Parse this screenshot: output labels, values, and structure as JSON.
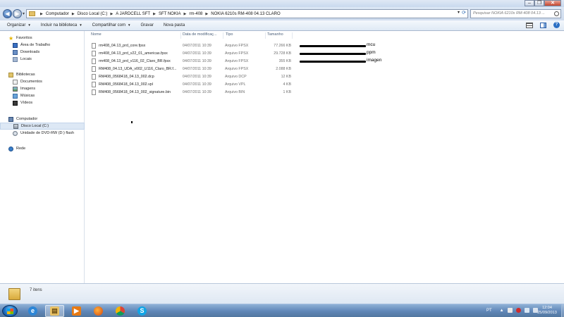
{
  "address": {
    "breadcrumbs": [
      "Computador",
      "Disco Local (C:)",
      "A JARDCELL SFT",
      "SFT NOKIA",
      "rm-408",
      "NOKIA 6210s RM-408 04.13 CLARO"
    ],
    "search_placeholder": "Pesquisar NOKIA 6210s RM-408 04.13 ..."
  },
  "toolbar": {
    "organize": "Organizar",
    "include": "Incluir na biblioteca",
    "share": "Compartilhar com",
    "burn": "Gravar",
    "new_folder": "Nova pasta"
  },
  "nav": {
    "favorites": {
      "label": "Favoritos",
      "items": [
        "Área de Trabalho",
        "Downloads",
        "Locais"
      ]
    },
    "libraries": {
      "label": "Bibliotecas",
      "items": [
        "Documentos",
        "Imagens",
        "Músicas",
        "Vídeos"
      ]
    },
    "computer": {
      "label": "Computador",
      "items": [
        "Disco Local (C:)",
        "Unidade de DVD-RW (D:) flash"
      ]
    },
    "network": {
      "label": "Rede"
    }
  },
  "columns": {
    "name": "Nome",
    "date": "Data de modificaç...",
    "type": "Tipo",
    "size": "Tamanho"
  },
  "files": [
    {
      "name": "rm408_04.13_prd_core.fpsx",
      "date": "04/07/2011 10:39",
      "type": "Arquivo FPSX",
      "size": "77.266 KB",
      "annotation": "mcu"
    },
    {
      "name": "rm408_04.13_prd_v22_01_americas.fpsx",
      "date": "04/07/2011 10:39",
      "type": "Arquivo FPSX",
      "size": "29.728 KB",
      "annotation": "ppm"
    },
    {
      "name": "rm408_04.13_prd_v116_02_Claro_BR.fpsx",
      "date": "04/07/2011 10:39",
      "type": "Arquivo FPSX",
      "size": "355 KB",
      "annotation": "imagen"
    },
    {
      "name": "RM408_04.13_UDA_v002_U116_Claro_BR.f...",
      "date": "04/07/2011 10:39",
      "type": "Arquivo FPSX",
      "size": "2.088 KB"
    },
    {
      "name": "RM408_0568418_04.13_002.dcp",
      "date": "04/07/2011 10:39",
      "type": "Arquivo DCP",
      "size": "12 KB"
    },
    {
      "name": "RM408_0568418_04.13_002.vpl",
      "date": "04/07/2011 10:39",
      "type": "Arquivo VPL",
      "size": "4 KB"
    },
    {
      "name": "RM408_0568418_04.13_002_signature.bin",
      "date": "04/07/2011 10:39",
      "type": "Arquivo BIN",
      "size": "1 KB"
    }
  ],
  "details": {
    "item_count": "7 itens"
  },
  "taskbar": {
    "language": "PT",
    "time": "12:04",
    "date": "25/09/2013"
  }
}
